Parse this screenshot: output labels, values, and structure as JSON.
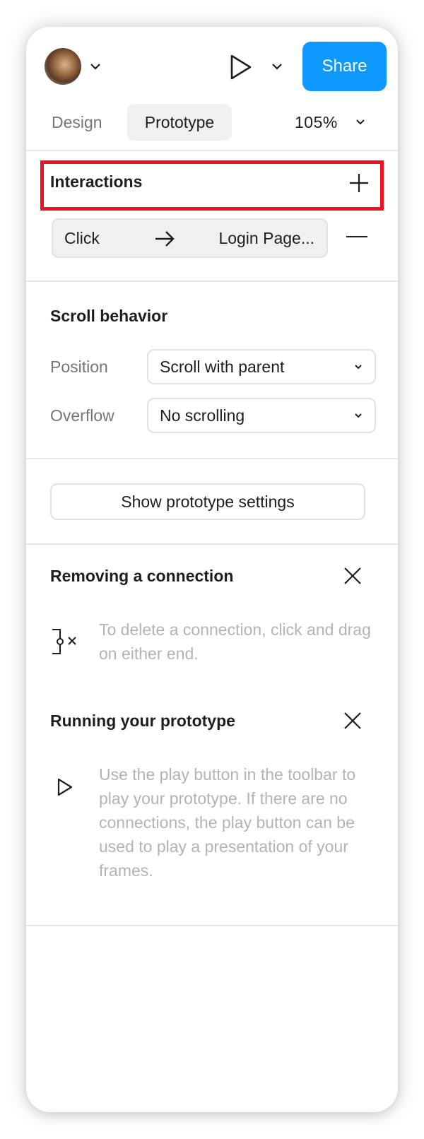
{
  "header": {
    "share_label": "Share",
    "tabs": [
      {
        "label": "Design",
        "active": false
      },
      {
        "label": "Prototype",
        "active": true
      }
    ],
    "zoom": "105%"
  },
  "interactions": {
    "title": "Interactions",
    "items": [
      {
        "trigger": "Click",
        "destination": "Login Page..."
      }
    ]
  },
  "scroll_behavior": {
    "title": "Scroll behavior",
    "position_label": "Position",
    "position_value": "Scroll with parent",
    "overflow_label": "Overflow",
    "overflow_value": "No scrolling"
  },
  "prototype_settings": {
    "button_label": "Show prototype settings"
  },
  "hints": [
    {
      "title": "Removing a connection",
      "text": "To delete a connection, click and drag on either end.",
      "icon": "connection-remove-icon"
    },
    {
      "title": "Running your prototype",
      "text": "Use the play button in the toolbar to play your prototype. If there are no connections, the play button can be used to play a presentation of your frames.",
      "icon": "play-icon"
    }
  ],
  "colors": {
    "accent": "#0d99ff",
    "highlight": "#ee1122",
    "muted_text": "#757575",
    "hint_text": "#b3b3b3"
  }
}
